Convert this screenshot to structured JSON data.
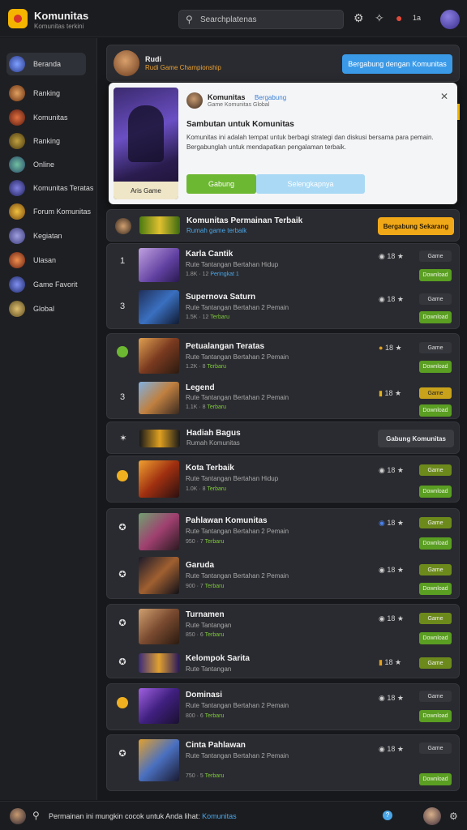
{
  "app": {
    "title": "Komunitas",
    "subtitle": "Komunitas terkini",
    "search_placeholder": "Searchplatenas",
    "notif_count": "1a"
  },
  "sidebar": {
    "items": [
      {
        "label": "Beranda",
        "active": true
      },
      {
        "label": "Ranking"
      },
      {
        "label": "Komunitas"
      },
      {
        "label": "Ranking"
      },
      {
        "label": "Online"
      },
      {
        "label": "Komunitas Teratas"
      },
      {
        "label": "Forum Komunitas"
      },
      {
        "label": "Kegiatan"
      },
      {
        "label": "Ulasan"
      },
      {
        "label": "Game Favorit"
      },
      {
        "label": "Global"
      }
    ]
  },
  "header_card": {
    "name": "Rudi",
    "subtitle": "Rudi Game Championship",
    "button": "Bergabung dengan Komunitas"
  },
  "popup": {
    "art_label": "Aris Game",
    "name": "Komunitas",
    "tag": "Bergabung",
    "sub": "Game Komunitas Global",
    "heading": "Sambutan untuk Komunitas",
    "body": "Komunitas ini adalah tempat untuk berbagi strategi dan diskusi bersama para pemain. Bergabunglah untuk mendapatkan pengalaman terbaik.",
    "btn_primary": "Gabung",
    "btn_secondary": "Selengkapnya"
  },
  "group1": {
    "title": "Komunitas Permainan Terbaik",
    "sub": "Rumah game terbaik",
    "button": "Bergabung Sekarang"
  },
  "group2": {
    "title": "Hadiah Bagus",
    "sub": "Rumah Komunitas",
    "button": "Gabung Komunitas"
  },
  "rows": [
    {
      "rank": "1",
      "title": "Karla Cantik",
      "meta": "Rute Tantangan Bertahan Hidup",
      "stats_a": "1.8K · 12",
      "stats_b": "Peringkat 1",
      "count": "18",
      "tag": "Game",
      "action": "Download"
    },
    {
      "rank": "3",
      "title": "Supernova Saturn",
      "meta": "Rute Tantangan Bertahan 2 Pemain",
      "stats_a": "1.5K · 12",
      "stats_b": "Terbaru",
      "count": "18",
      "tag": "Game",
      "action": "Download"
    },
    {
      "rank": "",
      "title": "Petualangan Teratas",
      "meta": "Rute Tantangan Bertahan 2 Pemain",
      "stats_a": "1.2K · 8",
      "stats_b": "Terbaru",
      "count": "18",
      "tag": "Game",
      "action": "Download"
    },
    {
      "rank": "3",
      "title": "Legend",
      "meta": "Rute Tantangan Bertahan 2 Pemain",
      "stats_a": "1.1K · 8",
      "stats_b": "Terbaru",
      "count": "18",
      "tag": "Game",
      "action": "Download"
    },
    {
      "rank": "",
      "title": "Kota Terbaik",
      "meta": "Rute Tantangan Bertahan Hidup",
      "stats_a": "1.0K · 8",
      "stats_b": "Terbaru",
      "count": "18",
      "tag": "Game",
      "action": "Download"
    },
    {
      "rank": "",
      "title": "Pahlawan Komunitas",
      "meta": "Rute Tantangan Bertahan 2 Pemain",
      "stats_a": "950 · 7",
      "stats_b": "Terbaru",
      "count": "18",
      "tag": "Game",
      "action": "Download"
    },
    {
      "rank": "",
      "title": "Garuda",
      "meta": "Rute Tantangan Bertahan 2 Pemain",
      "stats_a": "900 · 7",
      "stats_b": "Terbaru",
      "count": "18",
      "tag": "Game",
      "action": "Download"
    },
    {
      "rank": "",
      "title": "Turnamen",
      "meta": "Rute Tantangan",
      "stats_a": "850 · 6",
      "stats_b": "Terbaru",
      "count": "18",
      "tag": "Game",
      "action": "Download"
    },
    {
      "rank": "",
      "title": "Kelompok Sarita",
      "meta": "Rute Tantangan",
      "stats_a": "",
      "stats_b": "",
      "count": "18",
      "tag": "Game",
      "action": ""
    },
    {
      "rank": "",
      "title": "Dominasi",
      "meta": "Rute Tantangan Bertahan 2 Pemain",
      "stats_a": "800 · 6",
      "stats_b": "Terbaru",
      "count": "18",
      "tag": "Game",
      "action": "Download"
    },
    {
      "rank": "",
      "title": "Cinta Pahlawan",
      "meta": "Rute Tantangan Bertahan 2 Pemain",
      "stats_a": "750 · 5",
      "stats_b": "Terbaru",
      "count": "18",
      "tag": "Game",
      "action": "Download"
    }
  ],
  "bottombar": {
    "text": "Permainan ini mungkin cocok untuk Anda lihat:",
    "link": "Komunitas"
  }
}
